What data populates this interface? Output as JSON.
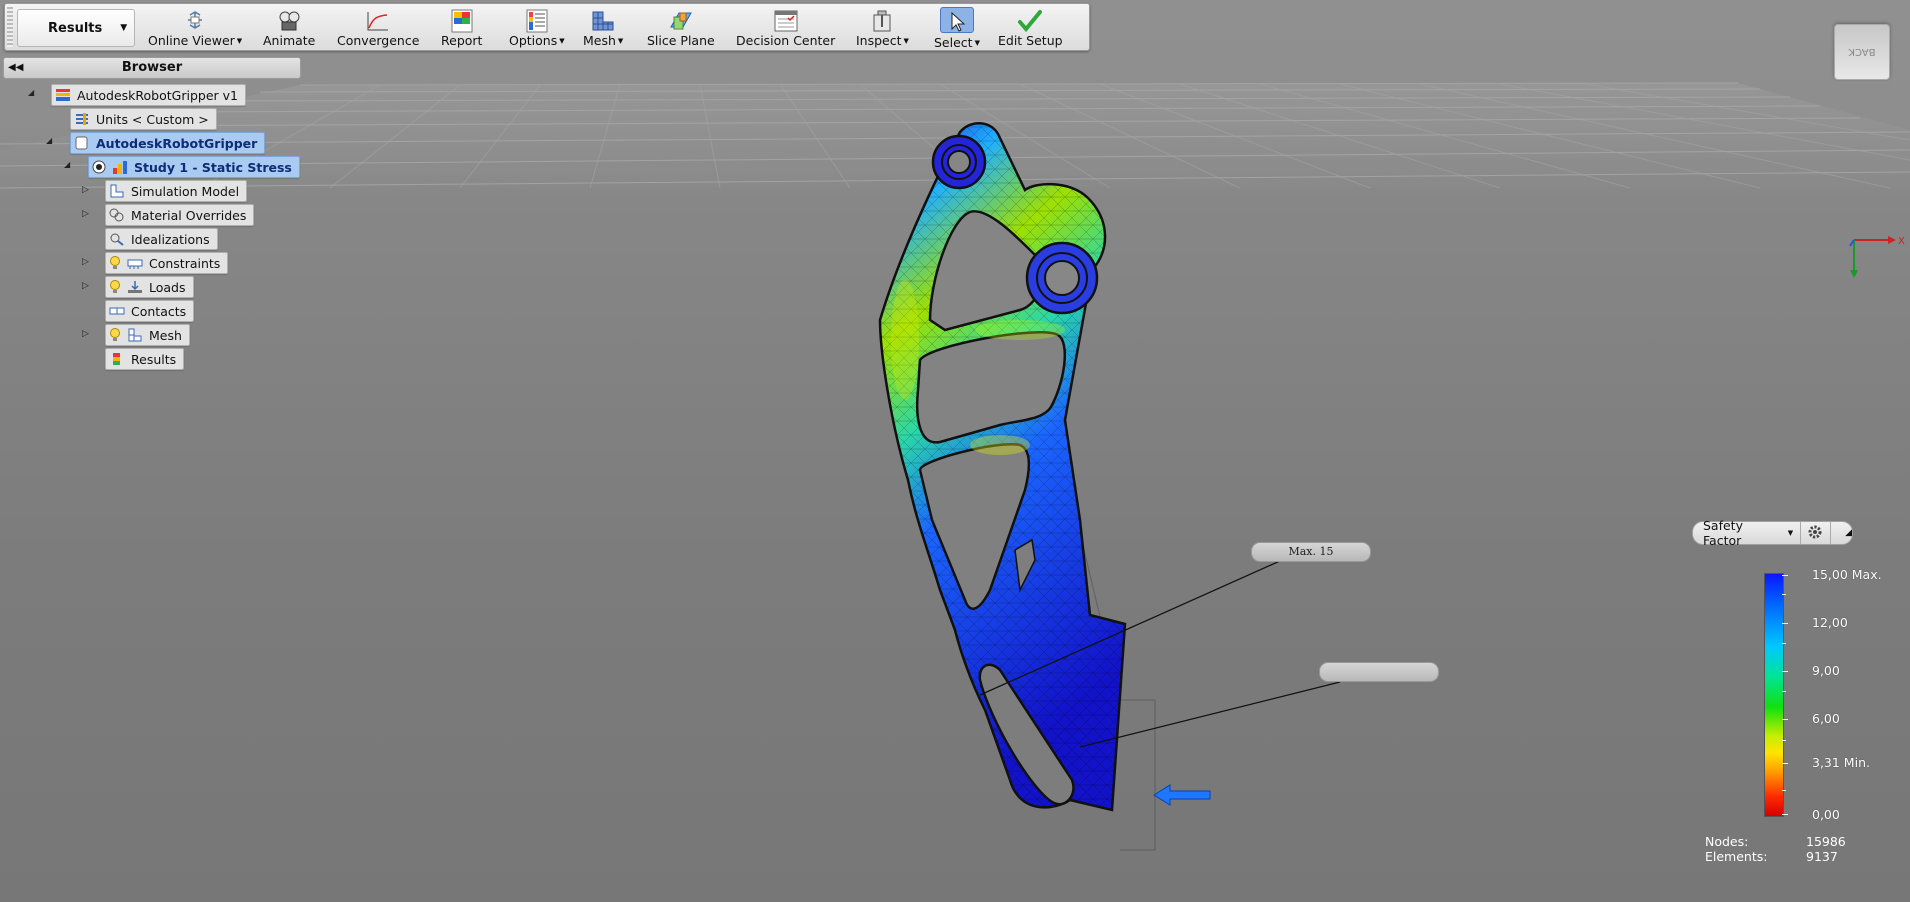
{
  "ribbon": {
    "env_tab": "Results",
    "tools": [
      {
        "label": "Online Viewer",
        "dropdown": true,
        "icon": "online-viewer-icon"
      },
      {
        "label": "Animate",
        "dropdown": false,
        "icon": "animate-icon"
      },
      {
        "label": "Convergence",
        "dropdown": false,
        "icon": "convergence-icon"
      },
      {
        "label": "Report",
        "dropdown": false,
        "icon": "report-icon"
      },
      {
        "label": "Options",
        "dropdown": true,
        "icon": "options-icon"
      },
      {
        "label": "Mesh",
        "dropdown": true,
        "icon": "mesh-icon"
      },
      {
        "label": "Slice Plane",
        "dropdown": false,
        "icon": "slice-plane-icon"
      },
      {
        "label": "Decision Center",
        "dropdown": false,
        "icon": "decision-center-icon"
      },
      {
        "label": "Inspect",
        "dropdown": true,
        "icon": "inspect-icon"
      },
      {
        "label": "Select",
        "dropdown": true,
        "icon": "select-cursor-icon",
        "active": true
      },
      {
        "label": "Edit Setup",
        "dropdown": false,
        "icon": "checkmark-icon"
      }
    ]
  },
  "browser": {
    "title": "Browser",
    "nodes": [
      {
        "label": "AutodeskRobotGripper v1",
        "icon": "assembly-icon",
        "selected": false
      },
      {
        "label": "Units < Custom >",
        "icon": "units-icon",
        "selected": false
      },
      {
        "label": "AutodeskRobotGripper",
        "icon": "component-icon",
        "selected": true
      },
      {
        "label": "Study 1 - Static Stress",
        "icon": "study-icon",
        "selected": true
      },
      {
        "label": "Simulation Model",
        "icon": "simulation-model-icon",
        "selected": false
      },
      {
        "label": "Material Overrides",
        "icon": "material-icon",
        "selected": false
      },
      {
        "label": "Idealizations",
        "icon": "idealizations-icon",
        "selected": false
      },
      {
        "label": "Constraints",
        "icon": "constraints-icon",
        "selected": false
      },
      {
        "label": "Loads",
        "icon": "loads-icon",
        "selected": false
      },
      {
        "label": "Contacts",
        "icon": "contacts-icon",
        "selected": false
      },
      {
        "label": "Mesh",
        "icon": "mesh-icon",
        "selected": false
      },
      {
        "label": "Results",
        "icon": "results-icon",
        "selected": false
      }
    ]
  },
  "viewcube": {
    "label": "BACK"
  },
  "axis": {
    "x_label": "X"
  },
  "legend": {
    "result_type": "Safety Factor",
    "values": [
      "15,00 Max.",
      "12,00",
      "9,00",
      "6,00",
      "3,31 Min.",
      "0,00"
    ],
    "colors": {
      "max": "#0a18ff",
      "min": "#d40000"
    }
  },
  "callouts": {
    "max_label": "Max. 15",
    "min_label": ""
  },
  "stats": {
    "nodes_label": "Nodes:",
    "nodes_value": "15986",
    "elements_label": "Elements:",
    "elements_value": "9137"
  },
  "colors": {
    "selection": "#a9cbf2",
    "load_arrow": "#1e78ff"
  }
}
